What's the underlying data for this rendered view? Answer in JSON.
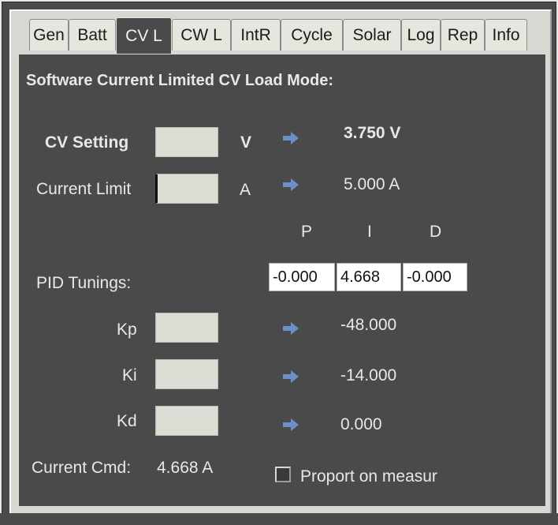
{
  "tabs": [
    "Gen",
    "Batt",
    "CV L",
    "CW L",
    "IntR",
    "Cycle",
    "Solar",
    "Log",
    "Rep",
    "Info"
  ],
  "active_tab": "CV L",
  "section_title": "Software Current Limited CV Load Mode:",
  "cv_setting": {
    "label": "CV Setting",
    "input_value": "",
    "unit": "V",
    "readback": "3.750 V"
  },
  "current_limit": {
    "label": "Current Limit",
    "input_value": "",
    "unit": "A",
    "readback": "5.000 A"
  },
  "pid": {
    "label": "PID Tunings:",
    "headers": {
      "p": "P",
      "i": "I",
      "d": "D"
    },
    "values": {
      "p": "-0.000",
      "i": "4.668",
      "d": "-0.000"
    }
  },
  "kp": {
    "label": "Kp",
    "input_value": "",
    "readback": "-48.000"
  },
  "ki": {
    "label": "Ki",
    "input_value": "",
    "readback": "-14.000"
  },
  "kd": {
    "label": "Kd",
    "input_value": "",
    "readback": "0.000"
  },
  "current_cmd": {
    "label": "Current Cmd:",
    "value": "4.668 A"
  },
  "proport_checkbox": {
    "label": "Proport on measur",
    "checked": false
  },
  "colors": {
    "arrow": "#6d8fc7",
    "panel": "#4a4a4a",
    "field": "#dcdcd4"
  }
}
